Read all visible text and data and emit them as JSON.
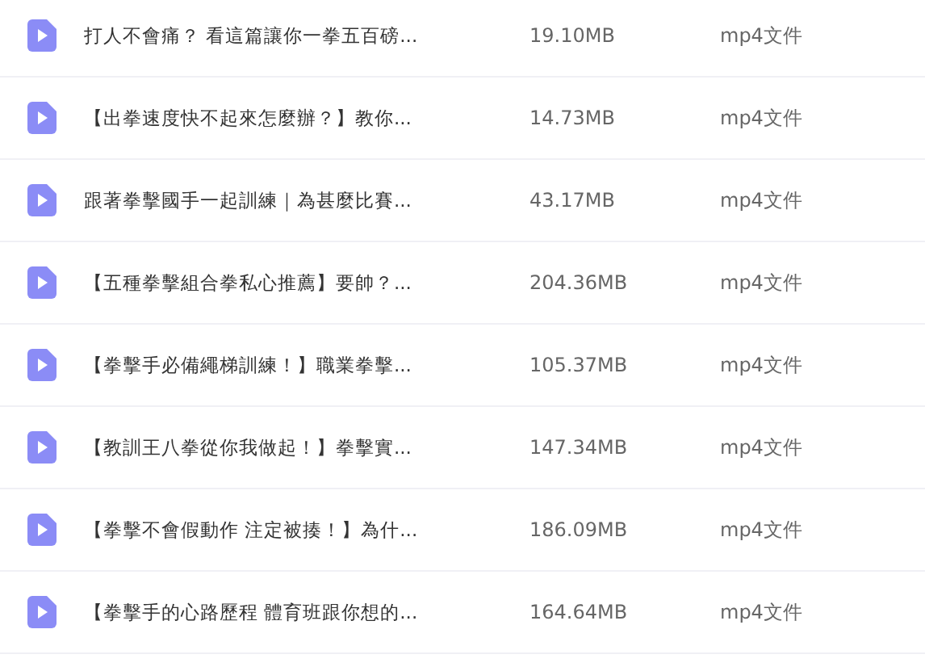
{
  "files": [
    {
      "name": "打人不會痛？ 看這篇讓你一拳五百磅...",
      "size": "19.10MB",
      "type": "mp4文件"
    },
    {
      "name": "【出拳速度快不起來怎麼辦？】教你...",
      "size": "14.73MB",
      "type": "mp4文件"
    },
    {
      "name": "跟著拳擊國手一起訓練｜為甚麼比賽...",
      "size": "43.17MB",
      "type": "mp4文件"
    },
    {
      "name": "【五種拳擊組合拳私心推薦】要帥？...",
      "size": "204.36MB",
      "type": "mp4文件"
    },
    {
      "name": "【拳擊手必備繩梯訓練！】職業拳擊...",
      "size": "105.37MB",
      "type": "mp4文件"
    },
    {
      "name": "【教訓王八拳從你我做起！】拳擊實...",
      "size": "147.34MB",
      "type": "mp4文件"
    },
    {
      "name": "【拳擊不會假動作 注定被揍！】為什...",
      "size": "186.09MB",
      "type": "mp4文件"
    },
    {
      "name": "【拳擊手的心路歷程 體育班跟你想的...",
      "size": "164.64MB",
      "type": "mp4文件"
    }
  ]
}
